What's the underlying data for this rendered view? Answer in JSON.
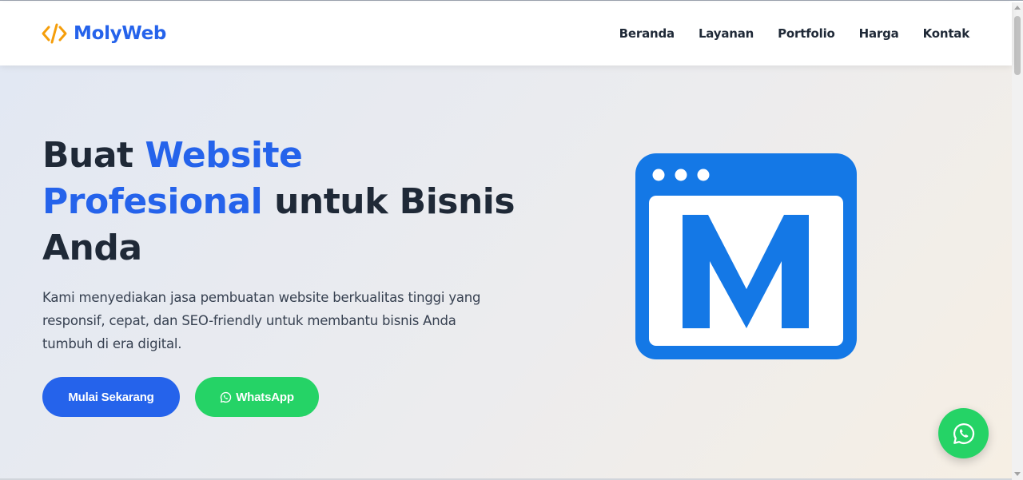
{
  "brand": {
    "name": "MolyWeb",
    "icon": "code-icon",
    "icon_color": "#f59e0b",
    "color": "#2563eb"
  },
  "nav": {
    "items": [
      "Beranda",
      "Layanan",
      "Portfolio",
      "Harga",
      "Kontak"
    ]
  },
  "hero": {
    "headline": {
      "part1": "Buat ",
      "highlight1": "Website",
      "highlight2": "Profesional",
      "part2": " untuk Bisnis Anda"
    },
    "description": "Kami menyediakan jasa pembuatan website berkualitas tinggi yang responsif, cepat, dan SEO-friendly untuk membantu bisnis Anda tumbuh di era digital.",
    "primary_button": "Mulai Sekarang",
    "whatsapp_button": "WhatsApp",
    "illustration": "browser-window-m-logo-icon"
  },
  "floating_button": {
    "icon": "whatsapp-icon"
  },
  "colors": {
    "accent": "#2563eb",
    "whatsapp": "#25d366",
    "illustration": "#1478e6"
  }
}
